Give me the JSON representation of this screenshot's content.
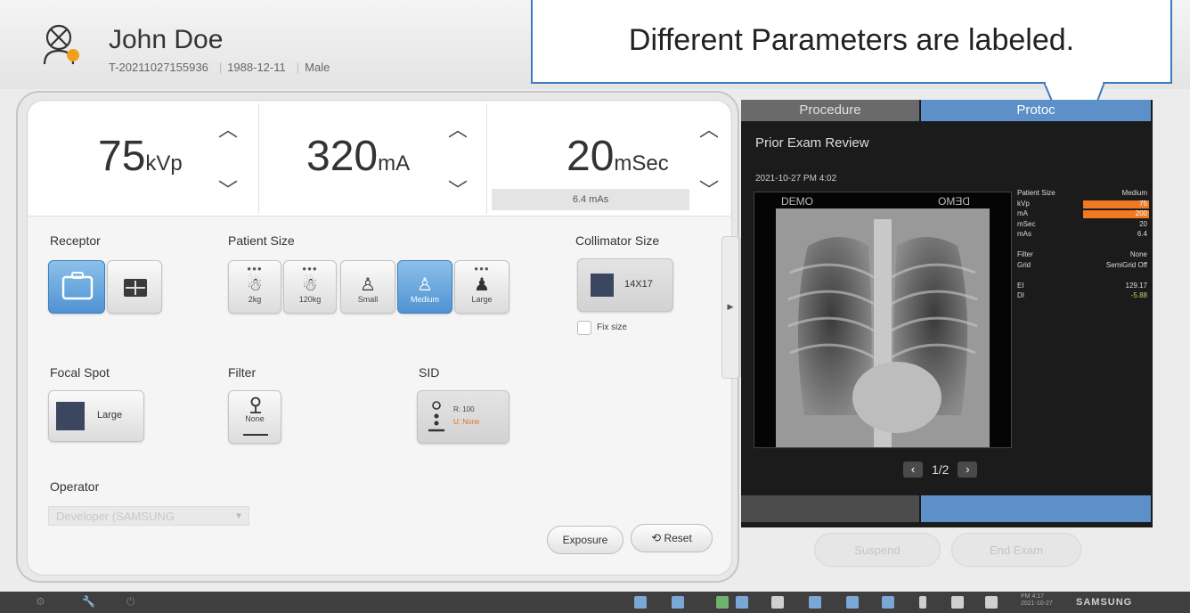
{
  "header": {
    "patient_name": "John Doe",
    "patient_id": "T-20211027155936",
    "birth_date": "1988-12-11",
    "sex": "Male"
  },
  "callout": {
    "text": "Different Parameters are labeled."
  },
  "exposure": {
    "kvp": {
      "value": "75",
      "unit": "kVp"
    },
    "ma": {
      "value": "320",
      "unit": "mA"
    },
    "time": {
      "value": "20",
      "unit": "mSec"
    },
    "mas": "6.4 mAs"
  },
  "receptor": {
    "label": "Receptor"
  },
  "patient_size": {
    "label": "Patient Size",
    "options": [
      "2kg",
      "120kg",
      "Small",
      "Medium",
      "Large"
    ],
    "selected": "Medium"
  },
  "collimator": {
    "label": "Collimator Size",
    "value": "14X17",
    "fix_size_label": "Fix size"
  },
  "focal_spot": {
    "label": "Focal Spot",
    "value": "Large"
  },
  "filter": {
    "label": "Filter",
    "value": "None"
  },
  "sid": {
    "label": "SID",
    "line1": "R: 100",
    "line2": "U: None"
  },
  "operator": {
    "label": "Operator",
    "value": "Developer (SAMSUNG"
  },
  "actions": {
    "exposure": "Exposure",
    "reset": "Reset"
  },
  "tabs": {
    "procedure": "Procedure",
    "protocol": "Protoc"
  },
  "prior_exam": {
    "title": "Prior Exam Review",
    "date": "2021-10-27 PM 4:02",
    "image_label_left": "DEMO",
    "image_label_right": "DEMO",
    "params": [
      {
        "key": "Patient Size",
        "value": "Medium",
        "highlight": false
      },
      {
        "key": "kVp",
        "value": "75",
        "highlight": true
      },
      {
        "key": "mA",
        "value": "200",
        "highlight": true
      },
      {
        "key": "mSec",
        "value": "20",
        "highlight": false
      },
      {
        "key": "mAs",
        "value": "6.4",
        "highlight": false
      },
      {
        "key": "",
        "value": "",
        "highlight": false
      },
      {
        "key": "Filter",
        "value": "None",
        "highlight": false
      },
      {
        "key": "Grid",
        "value": "SemiGrid Off",
        "highlight": false
      },
      {
        "key": "",
        "value": "",
        "highlight": false
      },
      {
        "key": "EI",
        "value": "129.17",
        "highlight": false
      },
      {
        "key": "DI",
        "value": "-5.88",
        "highlight": false
      }
    ],
    "pager": "1/2"
  },
  "bottom_actions": {
    "suspend": "Suspend",
    "end_exam": "End Exam"
  },
  "taskbar": {
    "brand": "SAMSUNG",
    "time": "PM 4:17",
    "date": "2021-10-27"
  },
  "colors": {
    "accent_blue": "#5d8fc8",
    "highlight_orange": "#f07a22",
    "dark_bg": "#1b1b1b"
  }
}
